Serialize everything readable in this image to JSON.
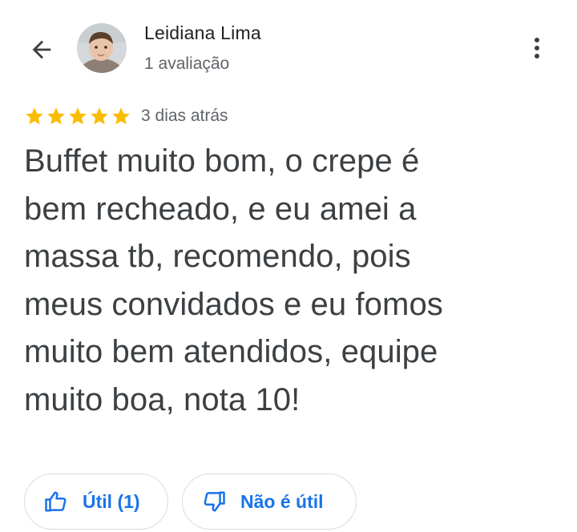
{
  "header": {
    "back_icon": "arrow-left-icon",
    "author_name": "Leidiana Lima",
    "author_meta": "1 avaliação",
    "more_icon": "more-vertical-icon"
  },
  "review": {
    "rating": 5,
    "max_rating": 5,
    "star_color": "#fbbc04",
    "date": "3 dias atrás",
    "text_lines": [
      "Buffet muito bom, o crepe é",
      "bem recheado, e eu amei a",
      "massa tb, recomendo, pois",
      "meus convidados e eu fomos",
      "muito bem atendidos, equipe",
      "muito boa, nota 10!"
    ]
  },
  "actions": {
    "helpful_label": "Útil (1)",
    "helpful_icon": "thumbs-up-icon",
    "unhelpful_label": "Não é útil",
    "unhelpful_icon": "thumbs-down-icon",
    "accent_color": "#1a73e8"
  }
}
